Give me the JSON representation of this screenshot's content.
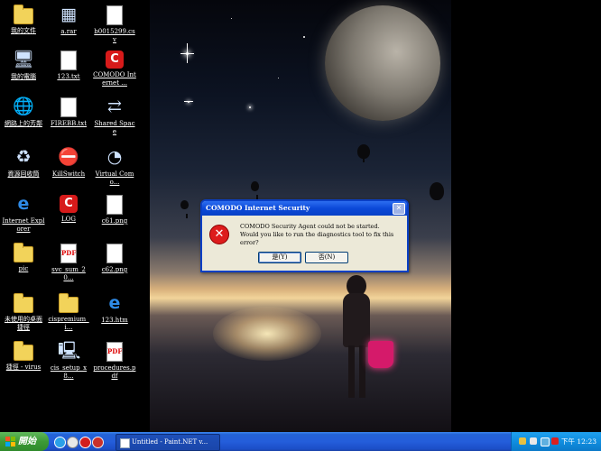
{
  "desktop": {
    "icons": [
      {
        "name": "my-documents",
        "label": "我的文件",
        "glyph": "folder"
      },
      {
        "name": "a-rar",
        "label": "a.rar",
        "glyph": "▦"
      },
      {
        "name": "b0015299-csv",
        "label": "b0015299.csv",
        "glyph": "doc"
      },
      {
        "name": "my-computer",
        "label": "我的電腦",
        "glyph": "🖥"
      },
      {
        "name": "123-txt",
        "label": "123.txt",
        "glyph": "doc"
      },
      {
        "name": "comodo-internet",
        "label": "COMODO Internet ...",
        "glyph": "comodo"
      },
      {
        "name": "network-places",
        "label": "網路上的芳鄰",
        "glyph": "🌐"
      },
      {
        "name": "firebb-txt",
        "label": "FIREBB.txt",
        "glyph": "doc"
      },
      {
        "name": "shared-space",
        "label": "Shared Space",
        "glyph": "⇄"
      },
      {
        "name": "recycle-bin",
        "label": "資源回收筒",
        "glyph": "♻"
      },
      {
        "name": "killswitch",
        "label": "KillSwitch",
        "glyph": "⛔"
      },
      {
        "name": "virtual-como",
        "label": "Virtual Como...",
        "glyph": "◔"
      },
      {
        "name": "internet-explorer",
        "label": "Internet Explorer",
        "glyph": "e"
      },
      {
        "name": "log",
        "label": "LOG",
        "glyph": "comodo"
      },
      {
        "name": "c61-png",
        "label": "c61.png",
        "glyph": "doc"
      },
      {
        "name": "pic",
        "label": "pic",
        "glyph": "folder"
      },
      {
        "name": "svc-sum-pdf",
        "label": "svc_sum_20...",
        "glyph": "pdf"
      },
      {
        "name": "c62-png",
        "label": "c62.png",
        "glyph": "doc"
      },
      {
        "name": "unused-desktop",
        "label": "未使用的桌面捷徑",
        "glyph": "folder"
      },
      {
        "name": "cispremium",
        "label": "cispremium_i...",
        "glyph": "folder"
      },
      {
        "name": "123-htm",
        "label": "123.htm",
        "glyph": "e"
      },
      {
        "name": "shortcut-virus",
        "label": "捷徑 - virus",
        "glyph": "folder"
      },
      {
        "name": "cis-setup",
        "label": "cis_setup_x8...",
        "glyph": "🖳"
      },
      {
        "name": "procedures-pdf",
        "label": "procedures.pdf",
        "glyph": "pdf"
      }
    ]
  },
  "dialog": {
    "title": "COMODO Internet Security",
    "close": "✕",
    "error_icon": "✕",
    "message_line1": "COMODO Security Agent could not be started.",
    "message_line2": "Would you like to run the diagnostics tool to fix this error?",
    "yes_label": "是(Y)",
    "no_label": "否(N)"
  },
  "taskbar": {
    "start_label": "開始",
    "window_button": "Untitled - Paint.NET v...",
    "clock": "下午 12:23"
  },
  "colors": {
    "xp_blue": "#245edb",
    "dialog_face": "#ece9d8",
    "start_green": "#3c9a36",
    "tray_blue": "#108ee0",
    "error_red": "#dd1c1c"
  }
}
